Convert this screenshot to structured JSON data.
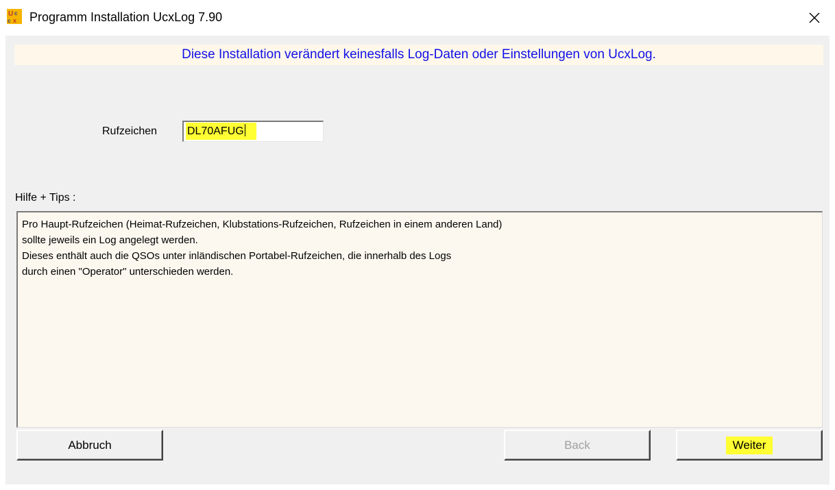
{
  "window": {
    "title": "Programm Installation UcxLog 7.90",
    "icon": "ucxlog-app-icon",
    "close_icon": "close-icon"
  },
  "banner": {
    "text": "Diese Installation verändert keinesfalls Log-Daten oder Einstellungen von UcxLog.",
    "color": "#1010e8"
  },
  "callsign": {
    "label": "Rufzeichen",
    "value": "DL70AFUG",
    "highlight_color": "#ffff33"
  },
  "help": {
    "label": "Hilfe + Tips :",
    "lines": [
      "Pro Haupt-Rufzeichen (Heimat-Rufzeichen, Klubstations-Rufzeichen, Rufzeichen in einem anderen Land)",
      "sollte jeweils ein Log angelegt werden.",
      "Dieses enthält auch die QSOs unter inländischen Portabel-Rufzeichen, die innerhalb des Logs",
      "durch einen \"Operator\" unterschieden werden."
    ]
  },
  "buttons": {
    "cancel": "Abbruch",
    "back": "Back",
    "next": "Weiter"
  }
}
